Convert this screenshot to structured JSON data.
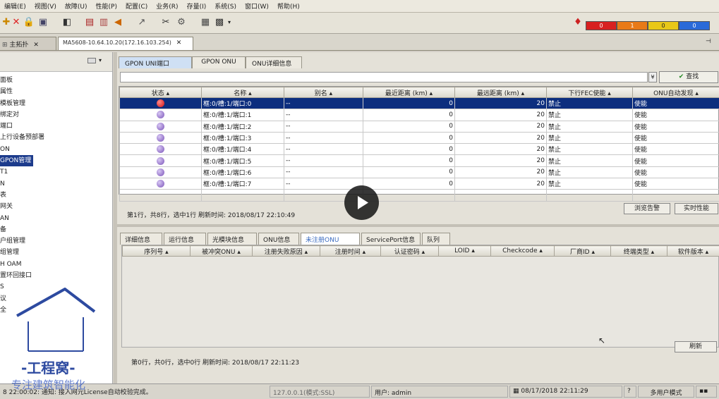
{
  "menu": [
    "编辑(E)",
    "视图(V)",
    "故障(U)",
    "性能(P)",
    "配置(C)",
    "业务(R)",
    "存量(I)",
    "系统(S)",
    "窗口(W)",
    "帮助(H)"
  ],
  "alarms": [
    {
      "value": "0",
      "color": "#d82020"
    },
    {
      "value": "1",
      "color": "#e87a18"
    },
    {
      "value": "0",
      "color": "#e8c818"
    },
    {
      "value": "0",
      "color": "#2a6ad8"
    }
  ],
  "doctabs": {
    "topo": "主拓扑",
    "device": "MA5608-10.64.10.20(172.16.103.254)"
  },
  "sidebar": {
    "items": [
      "面板",
      "属性",
      "模板管理",
      "绑定对",
      "端口",
      "上行设备预部署",
      "ON",
      "GPON管理",
      "T1",
      "N",
      "表",
      "网关",
      "AN",
      "备",
      "户组管理",
      "组管理",
      "H OAM",
      "置环回接口",
      "S",
      "议",
      "全"
    ],
    "selected_index": 7
  },
  "panel_tabs": [
    "GPON UNI端口",
    "GPON ONU",
    "ONU详细信息"
  ],
  "search_label": "查找",
  "grid1": {
    "columns": [
      "状态",
      "名称",
      "别名",
      "最近距离 (km)",
      "最远距离 (km)",
      "下行FEC使能",
      "ONU自动发现"
    ],
    "rows": [
      {
        "status": "red",
        "name": "框:0/槽:1/端口:0",
        "alias": "--",
        "min": "0",
        "max": "20",
        "fec": "禁止",
        "auto": "使能"
      },
      {
        "status": "purple",
        "name": "框:0/槽:1/端口:1",
        "alias": "--",
        "min": "0",
        "max": "20",
        "fec": "禁止",
        "auto": "使能"
      },
      {
        "status": "purple",
        "name": "框:0/槽:1/端口:2",
        "alias": "--",
        "min": "0",
        "max": "20",
        "fec": "禁止",
        "auto": "使能"
      },
      {
        "status": "purple",
        "name": "框:0/槽:1/端口:3",
        "alias": "--",
        "min": "0",
        "max": "20",
        "fec": "禁止",
        "auto": "使能"
      },
      {
        "status": "purple",
        "name": "框:0/槽:1/端口:4",
        "alias": "--",
        "min": "0",
        "max": "20",
        "fec": "禁止",
        "auto": "使能"
      },
      {
        "status": "purple",
        "name": "框:0/槽:1/端口:5",
        "alias": "--",
        "min": "0",
        "max": "20",
        "fec": "禁止",
        "auto": "使能"
      },
      {
        "status": "purple",
        "name": "框:0/槽:1/端口:6",
        "alias": "--",
        "min": "0",
        "max": "20",
        "fec": "禁止",
        "auto": "使能"
      },
      {
        "status": "purple",
        "name": "框:0/槽:1/端口:7",
        "alias": "--",
        "min": "0",
        "max": "20",
        "fec": "禁止",
        "auto": "使能"
      }
    ],
    "status_text": "第1行，共8行，选中1行   刷新时间: 2018/08/17 22:10:49",
    "btn_browse": "浏览告警",
    "btn_realtime": "实时性能"
  },
  "bottom_tabs": [
    "详细信息",
    "运行信息",
    "光模块信息",
    "ONU信息",
    "未注册ONU",
    "ServicePort信息",
    "队列"
  ],
  "grid2": {
    "columns": [
      "序列号",
      "被冲突ONU",
      "注册失败原因",
      "注册时间",
      "认证密码",
      "LOID",
      "Checkcode",
      "厂商ID",
      "终端类型",
      "软件版本"
    ],
    "status_text": "第0行，共0行，选中0行   刷新时间: 2018/08/17 22:11:23",
    "btn_refresh": "刷新"
  },
  "statusbar": {
    "msg": "8 22:00:02: 通知: 接入网元License自动校验完成。",
    "conn": "127.0.0.1(模式:SSL)",
    "user": "用户: admin",
    "datetime": "08/17/2018 22:11:29",
    "mode": "多用户模式"
  },
  "watermark": {
    "title": "-工程窝-",
    "subtitle": "专注建筑智能化"
  }
}
